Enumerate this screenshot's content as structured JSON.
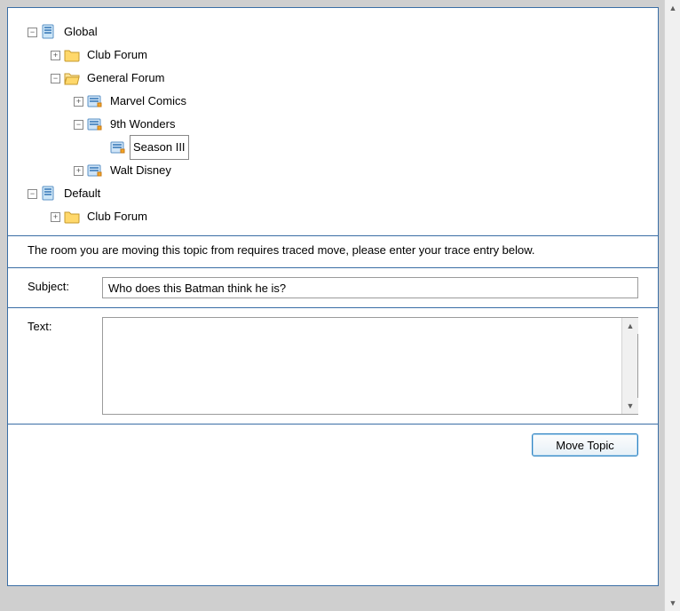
{
  "tree": {
    "global": "Global",
    "club_forum": "Club Forum",
    "general_forum": "General Forum",
    "marvel": "Marvel Comics",
    "ninth_wonders": "9th Wonders",
    "season3": "Season III",
    "walt_disney": "Walt Disney",
    "default": "Default",
    "club_forum2": "Club Forum"
  },
  "info_text": "The room you are moving this topic from requires traced move, please enter your trace entry below.",
  "form": {
    "subject_label": "Subject:",
    "subject_value": "Who does this Batman think he is?",
    "text_label": "Text:",
    "text_value": ""
  },
  "buttons": {
    "move_topic": "Move Topic"
  }
}
